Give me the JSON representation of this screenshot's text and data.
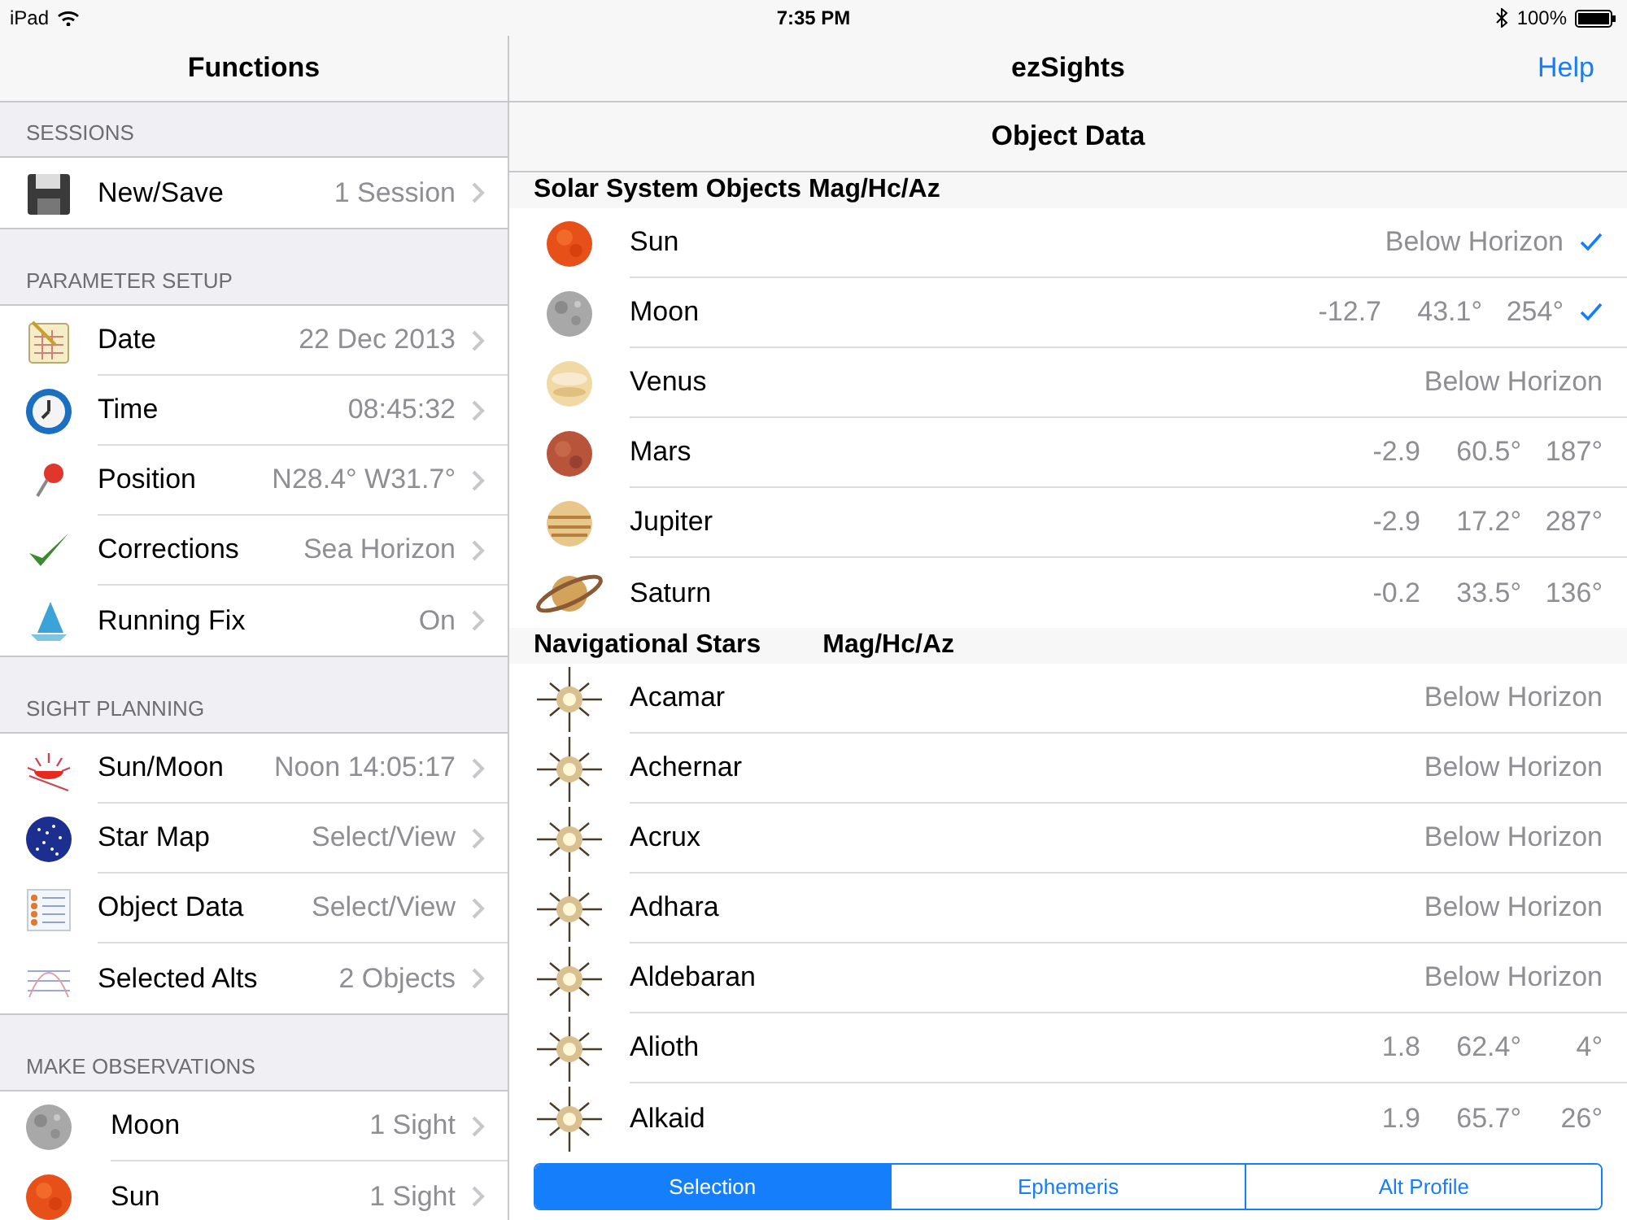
{
  "status_bar": {
    "device": "iPad",
    "time": "7:35 PM",
    "battery": "100%"
  },
  "sidebar": {
    "title": "Functions",
    "sections": [
      {
        "header": "SESSIONS",
        "items": [
          {
            "kind": "floppy",
            "label": "New/Save",
            "value": "1 Session"
          }
        ]
      },
      {
        "header": "PARAMETER SETUP",
        "items": [
          {
            "kind": "calendar",
            "label": "Date",
            "value": "22 Dec 2013"
          },
          {
            "kind": "clock",
            "label": "Time",
            "value": "08:45:32"
          },
          {
            "kind": "pin",
            "label": "Position",
            "value": "N28.4° W31.7°"
          },
          {
            "kind": "check",
            "label": "Corrections",
            "value": "Sea Horizon"
          },
          {
            "kind": "boat",
            "label": "Running Fix",
            "value": "On"
          }
        ]
      },
      {
        "header": "SIGHT PLANNING",
        "items": [
          {
            "kind": "sunrise",
            "label": "Sun/Moon",
            "value": "Noon 14:05:17"
          },
          {
            "kind": "starmap",
            "label": "Star Map",
            "value": "Select/View"
          },
          {
            "kind": "table",
            "label": "Object Data",
            "value": "Select/View"
          },
          {
            "kind": "chart",
            "label": "Selected Alts",
            "value": "2 Objects"
          }
        ]
      },
      {
        "header": "MAKE OBSERVATIONS",
        "items": [
          {
            "kind": "moon",
            "label": "Moon",
            "value": "1 Sight"
          },
          {
            "kind": "sun",
            "label": "Sun",
            "value": "1 Sight"
          }
        ]
      }
    ]
  },
  "main": {
    "title": "ezSights",
    "help": "Help",
    "subtitle": "Object Data",
    "sections": [
      {
        "title": "Solar System Objects Mag/Hc/Az",
        "rows": [
          {
            "kind": "sun",
            "name": "Sun",
            "reading": [
              "Below Horizon"
            ],
            "checked": true
          },
          {
            "kind": "moon",
            "name": "Moon",
            "reading": [
              "-12.7",
              "43.1°",
              "254°"
            ],
            "checked": true
          },
          {
            "kind": "venus",
            "name": "Venus",
            "reading": [
              "Below Horizon"
            ],
            "checked": false
          },
          {
            "kind": "mars",
            "name": "Mars",
            "reading": [
              "-2.9",
              "60.5°",
              "187°"
            ],
            "checked": false
          },
          {
            "kind": "jupiter",
            "name": "Jupiter",
            "reading": [
              "-2.9",
              "17.2°",
              "287°"
            ],
            "checked": false
          },
          {
            "kind": "saturn",
            "name": "Saturn",
            "reading": [
              "-0.2",
              "33.5°",
              "136°"
            ],
            "checked": false
          }
        ]
      },
      {
        "title": "Navigational Stars",
        "columns": "Mag/Hc/Az",
        "rows": [
          {
            "kind": "star",
            "name": "Acamar",
            "reading": [
              "Below Horizon"
            ],
            "checked": false
          },
          {
            "kind": "star",
            "name": "Achernar",
            "reading": [
              "Below Horizon"
            ],
            "checked": false
          },
          {
            "kind": "star",
            "name": "Acrux",
            "reading": [
              "Below Horizon"
            ],
            "checked": false
          },
          {
            "kind": "star",
            "name": "Adhara",
            "reading": [
              "Below Horizon"
            ],
            "checked": false
          },
          {
            "kind": "star",
            "name": "Aldebaran",
            "reading": [
              "Below Horizon"
            ],
            "checked": false
          },
          {
            "kind": "star",
            "name": "Alioth",
            "reading": [
              "1.8",
              "62.4°",
              "4°"
            ],
            "checked": false
          },
          {
            "kind": "star",
            "name": "Alkaid",
            "reading": [
              "1.9",
              "65.7°",
              "26°"
            ],
            "checked": false
          }
        ]
      }
    ],
    "segments": [
      {
        "label": "Selection",
        "selected": true
      },
      {
        "label": "Ephemeris",
        "selected": false
      },
      {
        "label": "Alt Profile",
        "selected": false
      }
    ]
  }
}
